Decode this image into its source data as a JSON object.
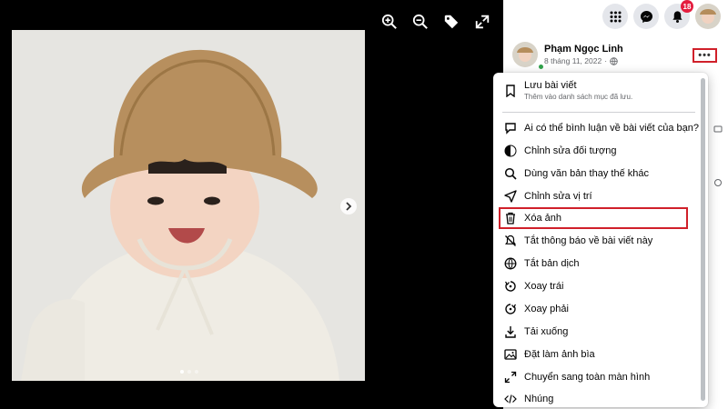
{
  "viewer": {
    "tools": [
      "zoom-in-icon",
      "zoom-out-icon",
      "tag-icon",
      "fullscreen-icon"
    ],
    "carousel": {
      "count": 3,
      "active": 1
    }
  },
  "topbar": {
    "notifications_badge": "18"
  },
  "post": {
    "author": "Phạm Ngọc Linh",
    "date": "8 tháng 11, 2022",
    "more_label": "•••"
  },
  "menu": {
    "save": {
      "label": "Lưu bài viết",
      "sub": "Thêm vào danh sách mục đã lưu."
    },
    "items": [
      {
        "label": "Ai có thể bình luận về bài viết của bạn?",
        "icon": "comment-icon"
      },
      {
        "label": "Chỉnh sửa đối tượng",
        "icon": "audience-icon"
      },
      {
        "label": "Dùng văn bản thay thế khác",
        "icon": "search-icon"
      },
      {
        "label": "Chỉnh sửa vị trí",
        "icon": "location-icon"
      },
      {
        "label": "Xóa ảnh",
        "icon": "trash-icon"
      },
      {
        "label": "Tắt thông báo về bài viết này",
        "icon": "bell-off-icon"
      },
      {
        "label": "Tắt bản dịch",
        "icon": "globe-icon"
      },
      {
        "label": "Xoay trái",
        "icon": "rotate-left-icon"
      },
      {
        "label": "Xoay phải",
        "icon": "rotate-right-icon"
      },
      {
        "label": "Tải xuống",
        "icon": "download-icon"
      },
      {
        "label": "Đặt làm ảnh bìa",
        "icon": "image-icon"
      },
      {
        "label": "Chuyển sang toàn màn hình",
        "icon": "fullscreen-icon"
      },
      {
        "label": "Nhúng",
        "icon": "embed-icon"
      }
    ]
  },
  "colors": {
    "accent_red": "#d0202a",
    "badge_red": "#e41e3f",
    "online_green": "#31a24c"
  }
}
